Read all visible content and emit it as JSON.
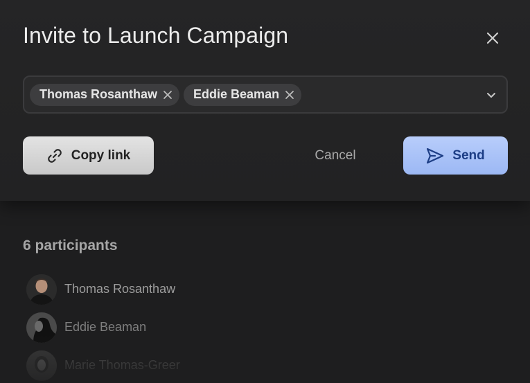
{
  "dialog": {
    "title": "Invite to Launch Campaign"
  },
  "picker": {
    "chips": [
      {
        "label": "Thomas Rosanthaw"
      },
      {
        "label": "Eddie Beaman"
      }
    ],
    "input_value": ""
  },
  "actions": {
    "copy_link_label": "Copy link",
    "cancel_label": "Cancel",
    "send_label": "Send"
  },
  "participants": {
    "count_label": "6 participants",
    "items": [
      {
        "name": "Thomas Rosanthaw"
      },
      {
        "name": "Eddie Beaman"
      },
      {
        "name": "Marie Thomas-Greer"
      }
    ]
  },
  "colors": {
    "send_bg": "#a9c3f8",
    "send_text": "#1d3e86",
    "copy_bg": "#d6d6d6",
    "background": "#1e1e1f"
  },
  "icons": {
    "close": "close-icon",
    "chip_remove": "x-icon",
    "dropdown": "chevron-down-icon",
    "copy_link": "link-icon",
    "send": "paper-plane-icon"
  }
}
